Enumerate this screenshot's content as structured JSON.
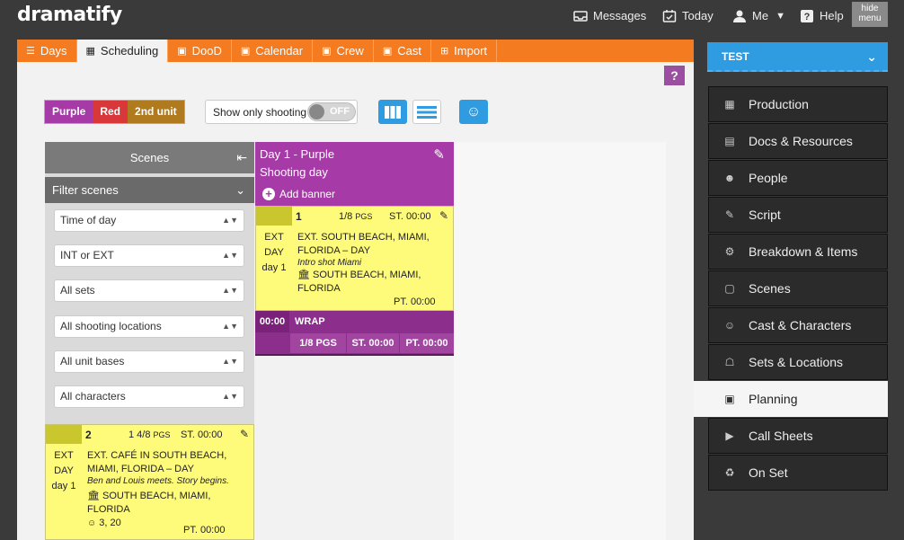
{
  "app": {
    "logo": "dramatify",
    "hide_menu": "hide\nmenu"
  },
  "topnav": {
    "messages": "Messages",
    "today": "Today",
    "me": "Me",
    "help": "Help"
  },
  "tabs": [
    {
      "label": "Days",
      "icon": "list-icon",
      "active": false
    },
    {
      "label": "Scheduling",
      "icon": "grid-icon",
      "active": true
    },
    {
      "label": "DooD",
      "icon": "calendar-icon",
      "active": false
    },
    {
      "label": "Calendar",
      "icon": "calendar-icon",
      "active": false
    },
    {
      "label": "Crew",
      "icon": "calendar-icon",
      "active": false
    },
    {
      "label": "Cast",
      "icon": "calendar-icon",
      "active": false
    },
    {
      "label": "Import",
      "icon": "import-icon",
      "active": false
    }
  ],
  "help_button": "?",
  "units": [
    {
      "label": "Purple",
      "color": "#a63aa6"
    },
    {
      "label": "Red",
      "color": "#d9383a"
    },
    {
      "label": "2nd unit",
      "color": "#b07a1f"
    }
  ],
  "toggle": {
    "label": "Show only shooting",
    "state": "OFF"
  },
  "scenes_panel": {
    "title": "Scenes",
    "filter_title": "Filter scenes",
    "filters": [
      "Time of day",
      "INT or EXT",
      "All sets",
      "All shooting locations",
      "All unit bases",
      "All characters"
    ]
  },
  "scene_left": {
    "number": "2",
    "pages": "1 4/8",
    "pages_unit": "PGS",
    "start": "ST. 00:00",
    "side": [
      "EXT",
      "DAY",
      "day 1"
    ],
    "heading": "EXT. CAFÉ IN SOUTH BEACH, MIAMI, FLORIDA – DAY",
    "description": "Ben and Louis meets. Story begins.",
    "location": "SOUTH BEACH, MIAMI, FLORIDA",
    "cast": "3, 20",
    "pt": "PT. 00:00"
  },
  "day": {
    "title": "Day 1 - Purple",
    "subtitle": "Shooting day",
    "add_banner": "Add banner",
    "scene": {
      "number": "1",
      "pages": "1/8",
      "pages_unit": "PGS",
      "start": "ST. 00:00",
      "side": [
        "EXT",
        "DAY",
        "day 1"
      ],
      "heading": "EXT. SOUTH BEACH, MIAMI, FLORIDA – DAY",
      "description": "Intro shot Miami",
      "location": "SOUTH BEACH, MIAMI, FLORIDA",
      "pt": "PT. 00:00"
    },
    "wrap": {
      "time": "00:00",
      "label": "WRAP",
      "pages": "1/8 PGS",
      "start": "ST. 00:00",
      "pt": "PT. 00:00"
    }
  },
  "project": {
    "name": "TEST"
  },
  "menu": [
    {
      "label": "Production",
      "icon": "film-icon",
      "active": false
    },
    {
      "label": "Docs & Resources",
      "icon": "document-icon",
      "active": false
    },
    {
      "label": "People",
      "icon": "people-icon",
      "active": false
    },
    {
      "label": "Script",
      "icon": "script-icon",
      "active": false
    },
    {
      "label": "Breakdown & Items",
      "icon": "breakdown-icon",
      "active": false
    },
    {
      "label": "Scenes",
      "icon": "scenes-icon",
      "active": false
    },
    {
      "label": "Cast & Characters",
      "icon": "masks-icon",
      "active": false
    },
    {
      "label": "Sets & Locations",
      "icon": "sets-icon",
      "active": false
    },
    {
      "label": "Planning",
      "icon": "calendar-icon",
      "active": true
    },
    {
      "label": "Call Sheets",
      "icon": "megaphone-icon",
      "active": false
    },
    {
      "label": "On Set",
      "icon": "director-chair-icon",
      "active": false
    }
  ],
  "colors": {
    "accent_orange": "#f47b20",
    "purple": "#a63aa6",
    "blue": "#2f9be0",
    "scene_yellow": "#fffb7a"
  }
}
